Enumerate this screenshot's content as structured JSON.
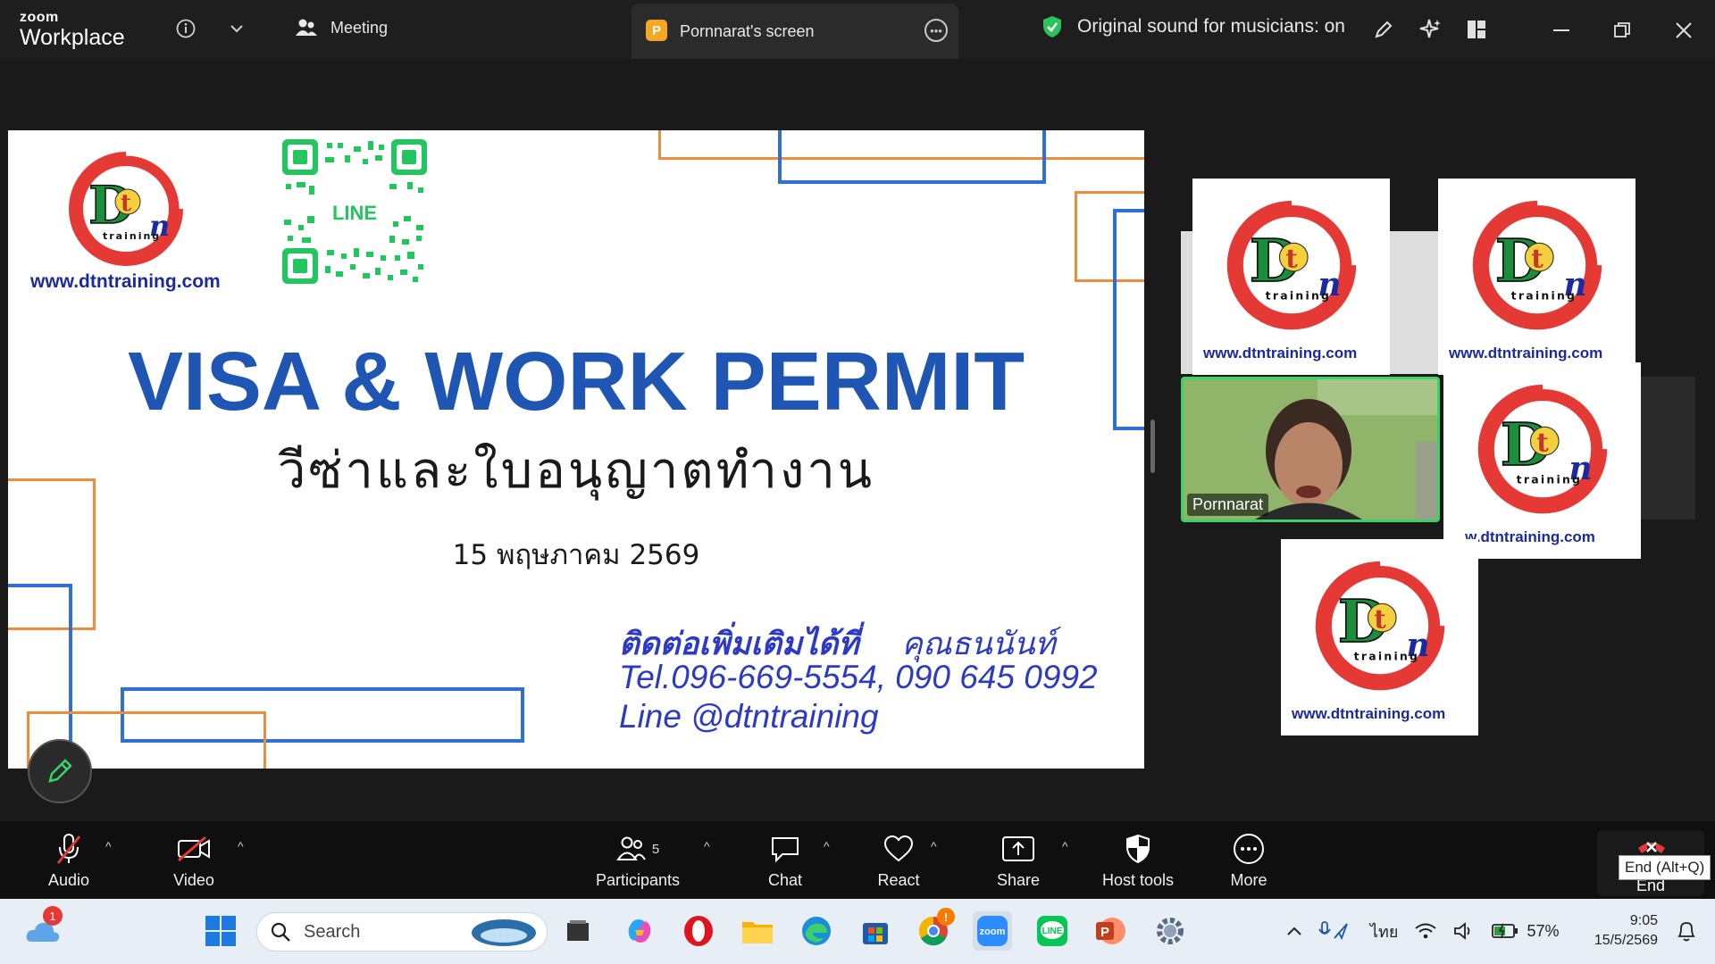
{
  "app": {
    "brand_line1": "zoom",
    "brand_line2": "Workplace"
  },
  "topbar": {
    "meeting_label": "Meeting",
    "share_badge": "P",
    "share_tab_label": "Pornnarat's screen",
    "sound_status": "Original sound for musicians: on"
  },
  "slide": {
    "website": "www.dtntraining.com",
    "qr_label": "LINE",
    "title": "VISA & WORK PERMIT",
    "subtitle": "วีซ่าและใบอนุญาตทำงาน",
    "date": "15 พฤษภาคม 2569",
    "contact_heading": "ติดต่อเพิ่มเติมได้ที่",
    "contact_name": "คุณธนนันท์",
    "tel": "Tel.096-669-5554, 090 645 0992",
    "line": "Line @dtntraining"
  },
  "gallery": {
    "tile_url": "www.dtntraining.com",
    "tile_url_cut": "...w.dtntraining.com",
    "video_participant": "Pornnarat"
  },
  "toolbar": {
    "audio": "Audio",
    "video": "Video",
    "participants": "Participants",
    "participants_count": "5",
    "chat": "Chat",
    "react": "React",
    "share": "Share",
    "host_tools": "Host tools",
    "more": "More",
    "end": "End",
    "end_tooltip": "End (Alt+Q)"
  },
  "taskbar": {
    "search_placeholder": "Search",
    "weather_badge": "1",
    "chrome_badge": "!",
    "language": "ไทย",
    "battery": "57%",
    "time": "9:05",
    "date": "15/5/2569"
  },
  "colors": {
    "title_blue": "#1f56b3",
    "contact_blue": "#2d3bc4",
    "frame_orange": "#f08b3a",
    "frame_blue": "#2f6fd6",
    "active_speaker": "#3ad36a",
    "logo_red": "#e53935",
    "logo_green": "#1b8e3b"
  }
}
